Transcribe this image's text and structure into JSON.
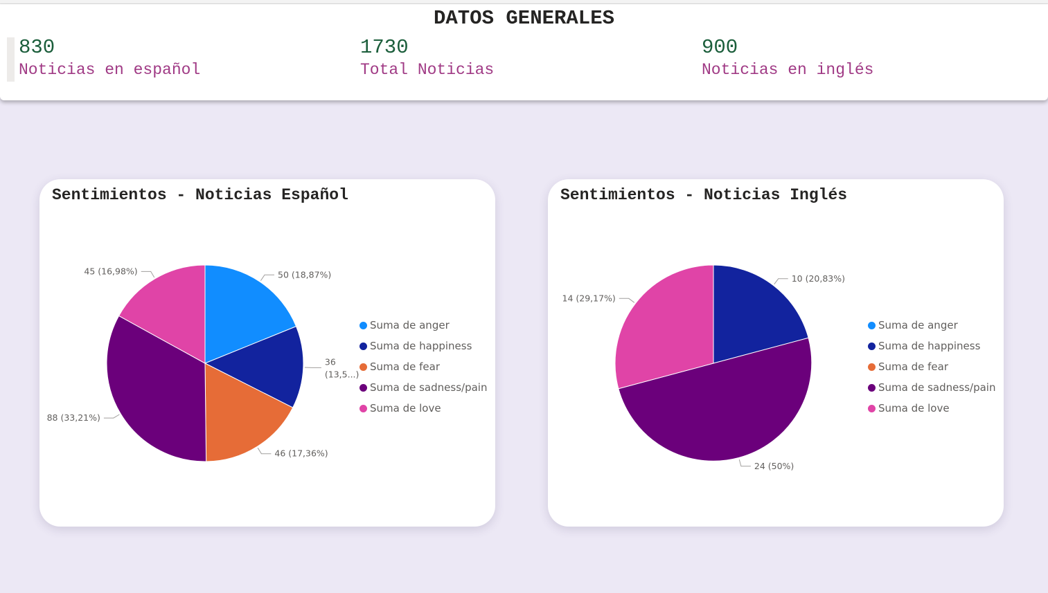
{
  "header": {
    "title": "DATOS GENERALES",
    "kpis": [
      {
        "value": "830",
        "label": "Noticias en español"
      },
      {
        "value": "1730",
        "label": "Total Noticias"
      },
      {
        "value": "900",
        "label": "Noticias en inglés"
      }
    ]
  },
  "colors": {
    "anger": "#118DFF",
    "happiness": "#12239E",
    "fear": "#E66C37",
    "sadness_pain": "#6B007B",
    "love": "#E044A7",
    "kpi_value": "#1B5E3B",
    "kpi_label": "#A03A85",
    "background": "#ECE8F5"
  },
  "chart_data": [
    {
      "type": "pie",
      "title": "Sentimientos - Noticias Español",
      "categories": [
        "Suma de anger",
        "Suma de happiness",
        "Suma de fear",
        "Suma de sadness/pain",
        "Suma de love"
      ],
      "values": [
        50,
        36,
        46,
        88,
        45
      ],
      "data_labels": [
        "50 (18,87%)",
        "36 (13,5...)",
        "46 (17,36%)",
        "88 (33,21%)",
        "45 (16,98%)"
      ],
      "legend": "right"
    },
    {
      "type": "pie",
      "title": "Sentimientos - Noticias Inglés",
      "categories": [
        "Suma de anger",
        "Suma de happiness",
        "Suma de fear",
        "Suma de sadness/pain",
        "Suma de love"
      ],
      "values": [
        0,
        10,
        0,
        24,
        14
      ],
      "data_labels": [
        "",
        "10 (20,83%)",
        "",
        "24 (50%)",
        "14 (29,17%)"
      ],
      "legend": "right"
    }
  ]
}
